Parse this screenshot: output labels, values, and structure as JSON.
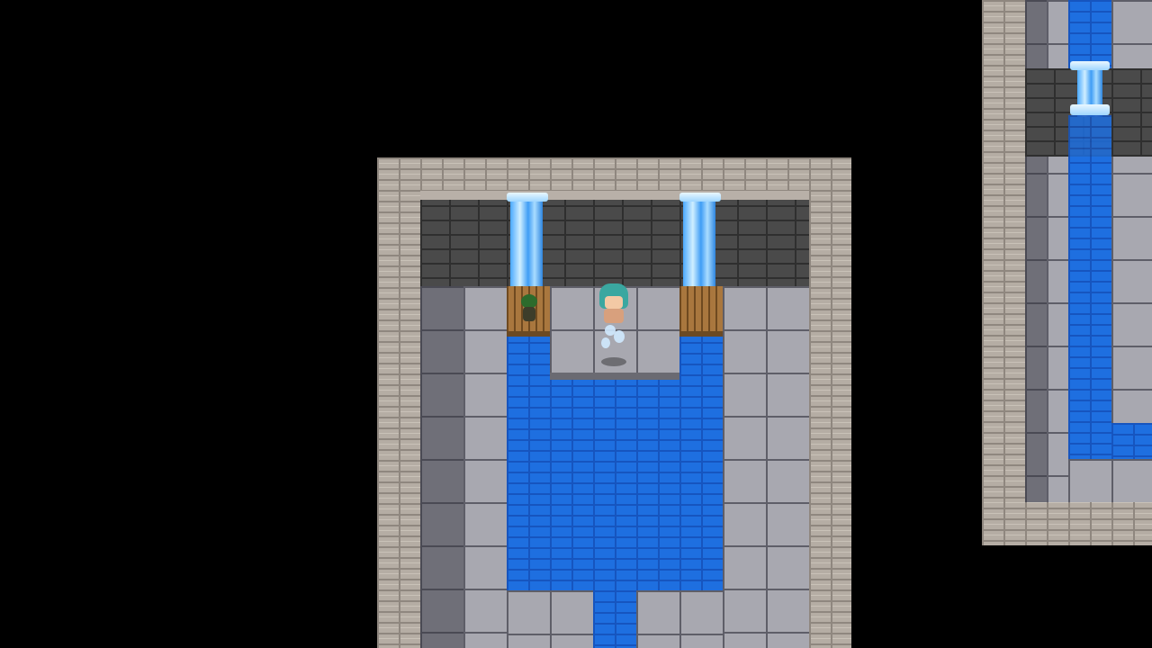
{
  "scene": {
    "name": "",
    "colors": {
      "background": "#000000",
      "stone_wall": "#b5ada4",
      "dark_brick": "#4a4a4a",
      "floor": "#a8a8b0",
      "water": "#1e6fe0",
      "wood": "#a9773e"
    },
    "characters": [
      {
        "role": "player",
        "hair_color": "#3aa7a0"
      },
      {
        "role": "npc",
        "color": "#2c6b2c"
      }
    ]
  }
}
